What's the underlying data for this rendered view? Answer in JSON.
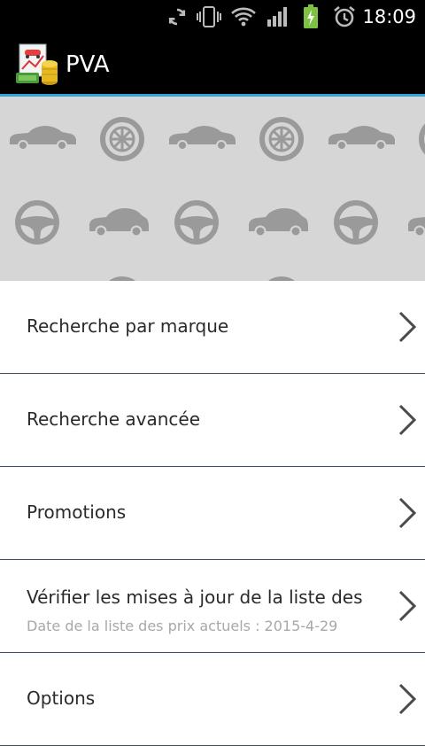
{
  "status_bar": {
    "time": "18:09",
    "icons": [
      "sync-icon",
      "vibrate-icon",
      "wifi-icon",
      "signal-icon",
      "battery-charging-icon",
      "alarm-icon"
    ],
    "battery_color": "#7dc242"
  },
  "action_bar": {
    "title": "PVA",
    "accent_color": "#3aa0d8"
  },
  "banner": {
    "background_color": "#d6d6d6",
    "icon_color": "#9a9a9a",
    "pattern_icons": [
      "car-icon",
      "wheel-icon",
      "steering-wheel-icon"
    ]
  },
  "menu": {
    "items": [
      {
        "label": "Recherche par marque"
      },
      {
        "label": "Recherche avancée"
      },
      {
        "label": "Promotions"
      },
      {
        "label": "Vérifier les mises à jour de la liste des",
        "sublabel": "Date de la liste des prix actuels : 2015-4-29"
      },
      {
        "label": "Options"
      }
    ]
  }
}
